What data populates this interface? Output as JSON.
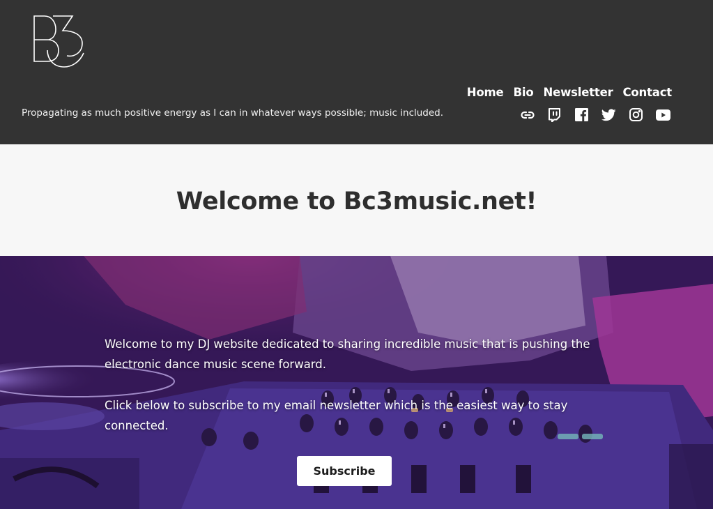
{
  "header": {
    "tagline": "Propagating as much positive energy as I can in whatever ways possible; music included.",
    "nav": [
      {
        "label": "Home"
      },
      {
        "label": "Bio"
      },
      {
        "label": "Newsletter"
      },
      {
        "label": "Contact"
      }
    ],
    "social_icons": [
      "link-icon",
      "twitch-icon",
      "facebook-icon",
      "twitter-icon",
      "instagram-icon",
      "youtube-icon"
    ]
  },
  "welcome": {
    "title": "Welcome to Bc3music.net!"
  },
  "hero": {
    "paragraph_1": "Welcome to my DJ website dedicated to sharing incredible music that is pushing the electronic dance music scene forward.",
    "paragraph_2": "Click below to subscribe to my email newsletter which is the easiest way to stay connected.",
    "subscribe_label": "Subscribe"
  },
  "colors": {
    "header_bg": "#333333",
    "band_bg": "#f7f7f7",
    "text_dark": "#2e2e2e",
    "hero_tint": "#5a2a8a"
  }
}
